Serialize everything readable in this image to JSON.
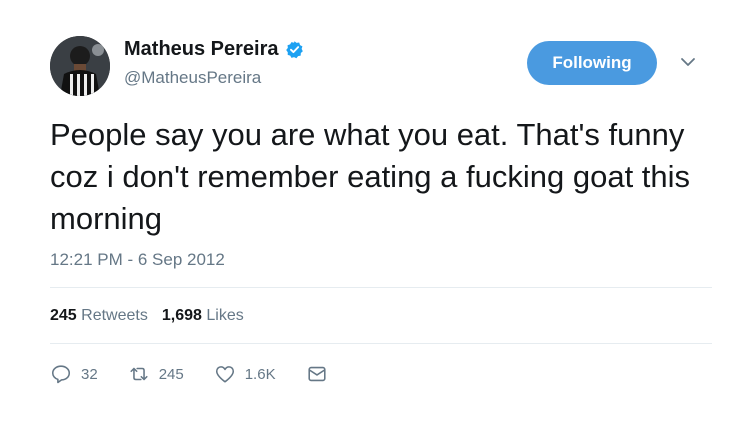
{
  "user": {
    "display_name": "Matheus Pereira",
    "handle": "@MatheusPereira",
    "verified": true,
    "avatar_icon": "profile-photo"
  },
  "follow_button": {
    "label": "Following",
    "color": "#4a9ae0"
  },
  "tweet": {
    "text": "People say you are what you eat. That's funny coz i don't remember eating a fucking goat this morning",
    "timestamp": "12:21 PM - 6 Sep 2012"
  },
  "stats": {
    "retweets_count": "245",
    "retweets_label": "Retweets",
    "likes_count": "1,698",
    "likes_label": "Likes"
  },
  "actions": {
    "reply_count": "32",
    "retweet_count": "245",
    "like_count": "1.6K",
    "icons": [
      "reply-icon",
      "retweet-icon",
      "like-icon",
      "message-icon"
    ]
  },
  "colors": {
    "accent": "#4a9ae0",
    "secondary_text": "#657786",
    "primary_text": "#14171a"
  }
}
